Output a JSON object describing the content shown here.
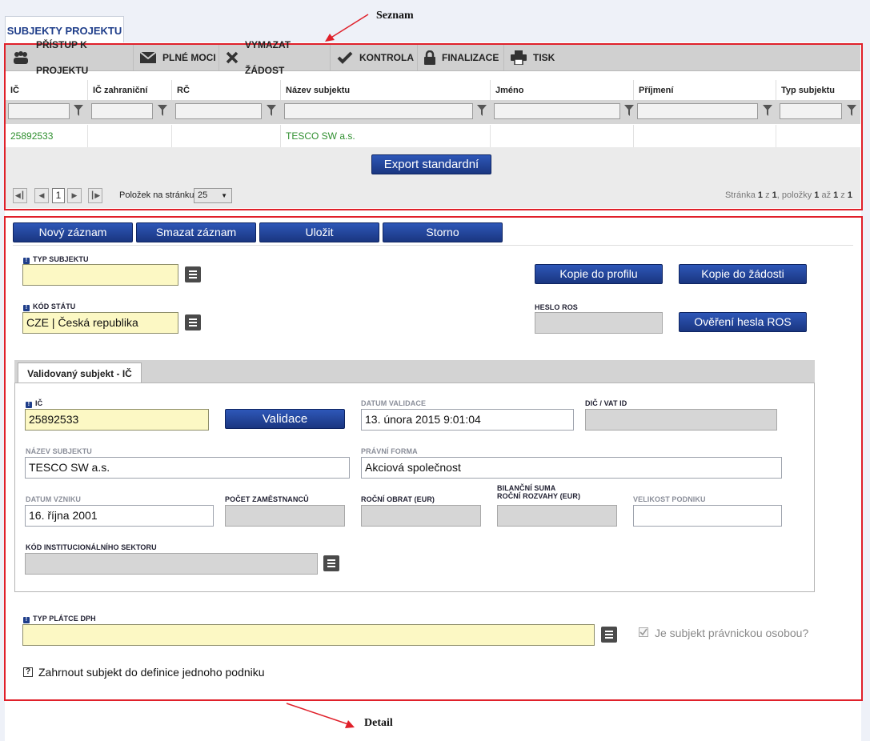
{
  "annotations": {
    "seznam": "Seznam",
    "detail": "Detail"
  },
  "page_tab": "SUBJEKTY PROJEKTU",
  "toolbar": [
    {
      "label": "PŘÍSTUP K PROJEKTU",
      "icon": "users-icon"
    },
    {
      "label": "PLNÉ MOCI",
      "icon": "envelope-icon"
    },
    {
      "label": "VYMAZAT ŽÁDOST",
      "icon": "x-icon"
    },
    {
      "label": "KONTROLA",
      "icon": "check-icon"
    },
    {
      "label": "FINALIZACE",
      "icon": "lock-icon"
    },
    {
      "label": "TISK",
      "icon": "printer-icon"
    }
  ],
  "grid": {
    "columns": [
      "IČ",
      "IČ zahraniční",
      "RČ",
      "Název subjektu",
      "Jméno",
      "Příjmení",
      "Typ subjektu"
    ],
    "rows": [
      [
        "25892533",
        "",
        "",
        "TESCO SW a.s.",
        "",
        "",
        ""
      ]
    ],
    "export_button": "Export standardní",
    "pager": {
      "current_page": "1",
      "per_page_label": "Položek na stránku",
      "per_page_value": "25"
    },
    "status": {
      "p1": "Stránka ",
      "b1": "1",
      "p2": " z ",
      "b2": "1",
      "p3": ", položky ",
      "b3": "1",
      "p4": " až ",
      "b4": "1",
      "p5": " z ",
      "b5": "1"
    }
  },
  "actions": {
    "new": "Nový záznam",
    "delete": "Smazat záznam",
    "save": "Uložit",
    "cancel": "Storno"
  },
  "form": {
    "typ_subjektu_label": "TYP SUBJEKTU",
    "typ_subjektu_value": "",
    "kod_statu_label": "KÓD STÁTU",
    "kod_statu_value": "CZE | Česká republika",
    "kopie_profil": "Kopie do profilu",
    "kopie_zadost": "Kopie do žádosti",
    "heslo_ros_label": "HESLO ROS",
    "heslo_ros_value": "",
    "overeni_button": "Ověření hesla ROS"
  },
  "subtab": "Validovaný subjekt - IČ",
  "validated": {
    "ic_label": "IČ",
    "ic_value": "25892533",
    "validace_button": "Validace",
    "datum_validace_label": "DATUM VALIDACE",
    "datum_validace_value": "13. února 2015 9:01:04",
    "dic_label": "DIČ / VAT ID",
    "dic_value": "",
    "nazev_label": "NÁZEV SUBJEKTU",
    "nazev_value": "TESCO SW a.s.",
    "pravni_forma_label": "PRÁVNÍ FORMA",
    "pravni_forma_value": "Akciová společnost",
    "datum_vzniku_label": "DATUM VZNIKU",
    "datum_vzniku_value": "16. října 2001",
    "pocet_label": "POČET ZAMĚSTNANCŮ",
    "pocet_value": "",
    "obrat_label": "ROČNÍ OBRAT (EUR)",
    "obrat_value": "",
    "bilance_label_1": "BILANČNÍ SUMA",
    "bilance_label_2": "ROČNÍ ROZVAHY (EUR)",
    "bilance_value": "",
    "velikost_label": "VELIKOST PODNIKU",
    "velikost_value": "",
    "kod_sektoru_label": "KÓD INSTITUCIONÁLNÍHO SEKTORU",
    "kod_sektoru_value": ""
  },
  "dph": {
    "label": "TYP PLÁTCE DPH",
    "value": "",
    "pravnicka_label": "Je subjekt právnickou osobou?",
    "zahrnout_label": "Zahrnout subjekt do definice jednoho podniku"
  },
  "colors": {
    "accent": "#1f3e8a",
    "button": "#2446a0",
    "highlight_red": "#e0202a",
    "required_field": "#fcf8c4",
    "green_text": "#2f8f2f"
  }
}
